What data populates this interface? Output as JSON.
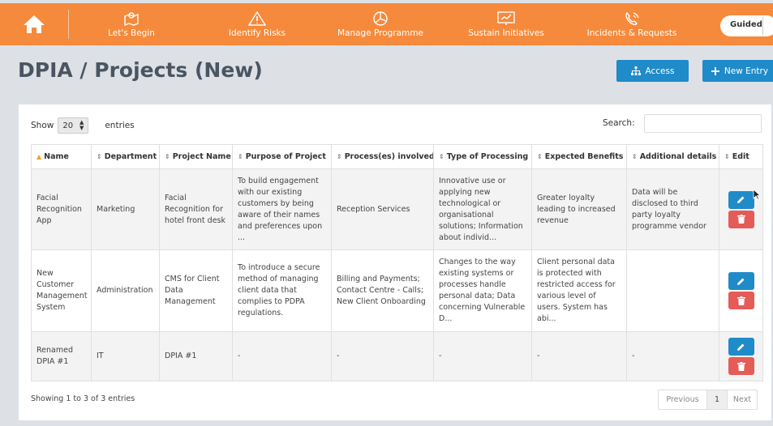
{
  "nav": {
    "items": [
      {
        "label": "Let's Begin",
        "icon": "map-icon"
      },
      {
        "label": "Identify Risks",
        "icon": "warning-icon"
      },
      {
        "label": "Manage Programme",
        "icon": "pie-chart-icon"
      },
      {
        "label": "Sustain Initiatives",
        "icon": "presentation-icon"
      },
      {
        "label": "Incidents & Requests",
        "icon": "phone-icon"
      }
    ],
    "guided_label": "Guided"
  },
  "page": {
    "title": "DPIA / Projects (New)",
    "access_label": "Access",
    "new_entry_label": "New Entry"
  },
  "table_controls": {
    "show_label": "Show",
    "page_size": "20",
    "entries_label": "entries",
    "search_label": "Search:",
    "search_value": ""
  },
  "table": {
    "columns": [
      "Name",
      "Department",
      "Project Name",
      "Purpose of Project",
      "Process(es) involved",
      "Type of Processing",
      "Expected Benefits",
      "Additional details",
      "Edit"
    ],
    "rows": [
      {
        "name": "Facial Recognition App",
        "department": "Marketing",
        "project_name": "Facial Recognition for hotel front desk",
        "purpose": "To build engagement with our existing customers by being aware of their names and preferences upon ...",
        "processes": "Reception Services",
        "processing_type": "Innovative use or applying new technological or organisational solutions; Information about individ...",
        "benefits": "Greater loyalty leading to increased revenue",
        "details": "Data will be disclosed to third party loyalty programme vendor"
      },
      {
        "name": "New Customer Management System",
        "department": "Administration",
        "project_name": "CMS for Client Data Management",
        "purpose": "To introduce a secure method of managing client data that complies to PDPA regulations.",
        "processes": "Billing and Payments; Contact Centre - Calls; New Client Onboarding",
        "processing_type": "Changes to the way existing systems or processes handle personal data; Data concerning Vulnerable D...",
        "benefits": "Client personal data is protected with restricted access for various level of users. System has abi...",
        "details": ""
      },
      {
        "name": "Renamed DPIA #1",
        "department": "IT",
        "project_name": "DPIA #1",
        "purpose": "-",
        "processes": "-",
        "processing_type": "-",
        "benefits": "-",
        "details": "-"
      }
    ]
  },
  "footer": {
    "info": "Showing 1 to 3 of 3 entries",
    "prev_label": "Previous",
    "current_page": "1",
    "next_label": "Next"
  },
  "colors": {
    "accent": "#f58a3c",
    "primary_button": "#1f8bc9",
    "delete_button": "#e45b57"
  }
}
